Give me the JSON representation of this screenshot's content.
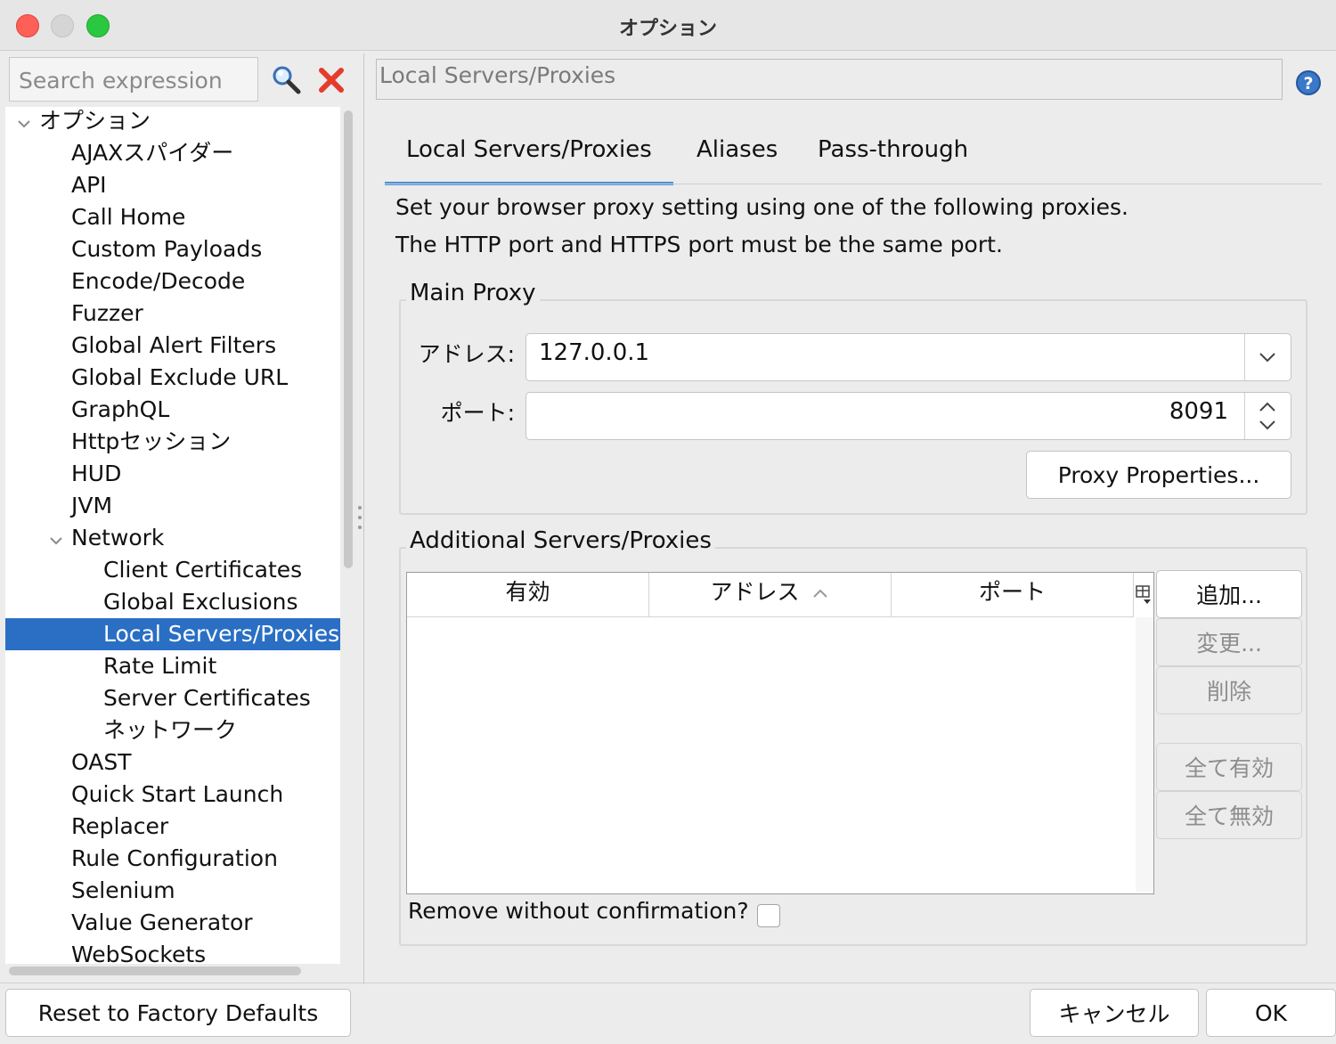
{
  "window": {
    "title": "オプション"
  },
  "search": {
    "placeholder": "Search expression"
  },
  "tree": {
    "items": [
      {
        "label": "オプション",
        "level": 0,
        "expanded": true
      },
      {
        "label": "AJAXスパイダー",
        "level": 1
      },
      {
        "label": "API",
        "level": 1
      },
      {
        "label": "Call Home",
        "level": 1
      },
      {
        "label": "Custom Payloads",
        "level": 1
      },
      {
        "label": "Encode/Decode",
        "level": 1
      },
      {
        "label": "Fuzzer",
        "level": 1
      },
      {
        "label": "Global Alert Filters",
        "level": 1
      },
      {
        "label": "Global Exclude URL",
        "level": 1
      },
      {
        "label": "GraphQL",
        "level": 1
      },
      {
        "label": "Httpセッション",
        "level": 1
      },
      {
        "label": "HUD",
        "level": 1
      },
      {
        "label": "JVM",
        "level": 1
      },
      {
        "label": "Network",
        "level": 1,
        "expanded": true
      },
      {
        "label": "Client Certificates",
        "level": 2
      },
      {
        "label": "Global Exclusions",
        "level": 2
      },
      {
        "label": "Local Servers/Proxies",
        "level": 2,
        "selected": true
      },
      {
        "label": "Rate Limit",
        "level": 2
      },
      {
        "label": "Server Certificates",
        "level": 2
      },
      {
        "label": "ネットワーク",
        "level": 2
      },
      {
        "label": "OAST",
        "level": 1
      },
      {
        "label": "Quick Start Launch",
        "level": 1
      },
      {
        "label": "Replacer",
        "level": 1
      },
      {
        "label": "Rule Configuration",
        "level": 1
      },
      {
        "label": "Selenium",
        "level": 1
      },
      {
        "label": "Value Generator",
        "level": 1
      },
      {
        "label": "WebSockets",
        "level": 1
      }
    ]
  },
  "panel": {
    "title": "Local Servers/Proxies"
  },
  "tabs": [
    {
      "label": "Local Servers/Proxies",
      "active": true
    },
    {
      "label": "Aliases"
    },
    {
      "label": "Pass-through"
    }
  ],
  "description": {
    "line1": "Set your browser proxy setting using one of the following proxies.",
    "line2": "The HTTP port and HTTPS port must be the same port."
  },
  "main_proxy": {
    "group_label": "Main Proxy",
    "address_label": "アドレス:",
    "address_value": "127.0.0.1",
    "port_label": "ポート:",
    "port_value": "8091",
    "properties_button": "Proxy Properties..."
  },
  "additional": {
    "group_label": "Additional Servers/Proxies",
    "columns": [
      "有効",
      "アドレス",
      "ポート"
    ],
    "rows": [],
    "buttons": {
      "add": "追加...",
      "modify": "変更...",
      "remove": "削除",
      "enable_all": "全て有効",
      "disable_all": "全て無効"
    },
    "remove_confirm_label": "Remove without confirmation?",
    "remove_confirm_checked": false
  },
  "footer": {
    "reset": "Reset to Factory Defaults",
    "cancel": "キャンセル",
    "ok": "OK"
  },
  "colors": {
    "selection": "#2a6fc4",
    "active_tab_underline": "#4a90d9",
    "close": "#fe5f57",
    "maximize": "#2ac840"
  }
}
